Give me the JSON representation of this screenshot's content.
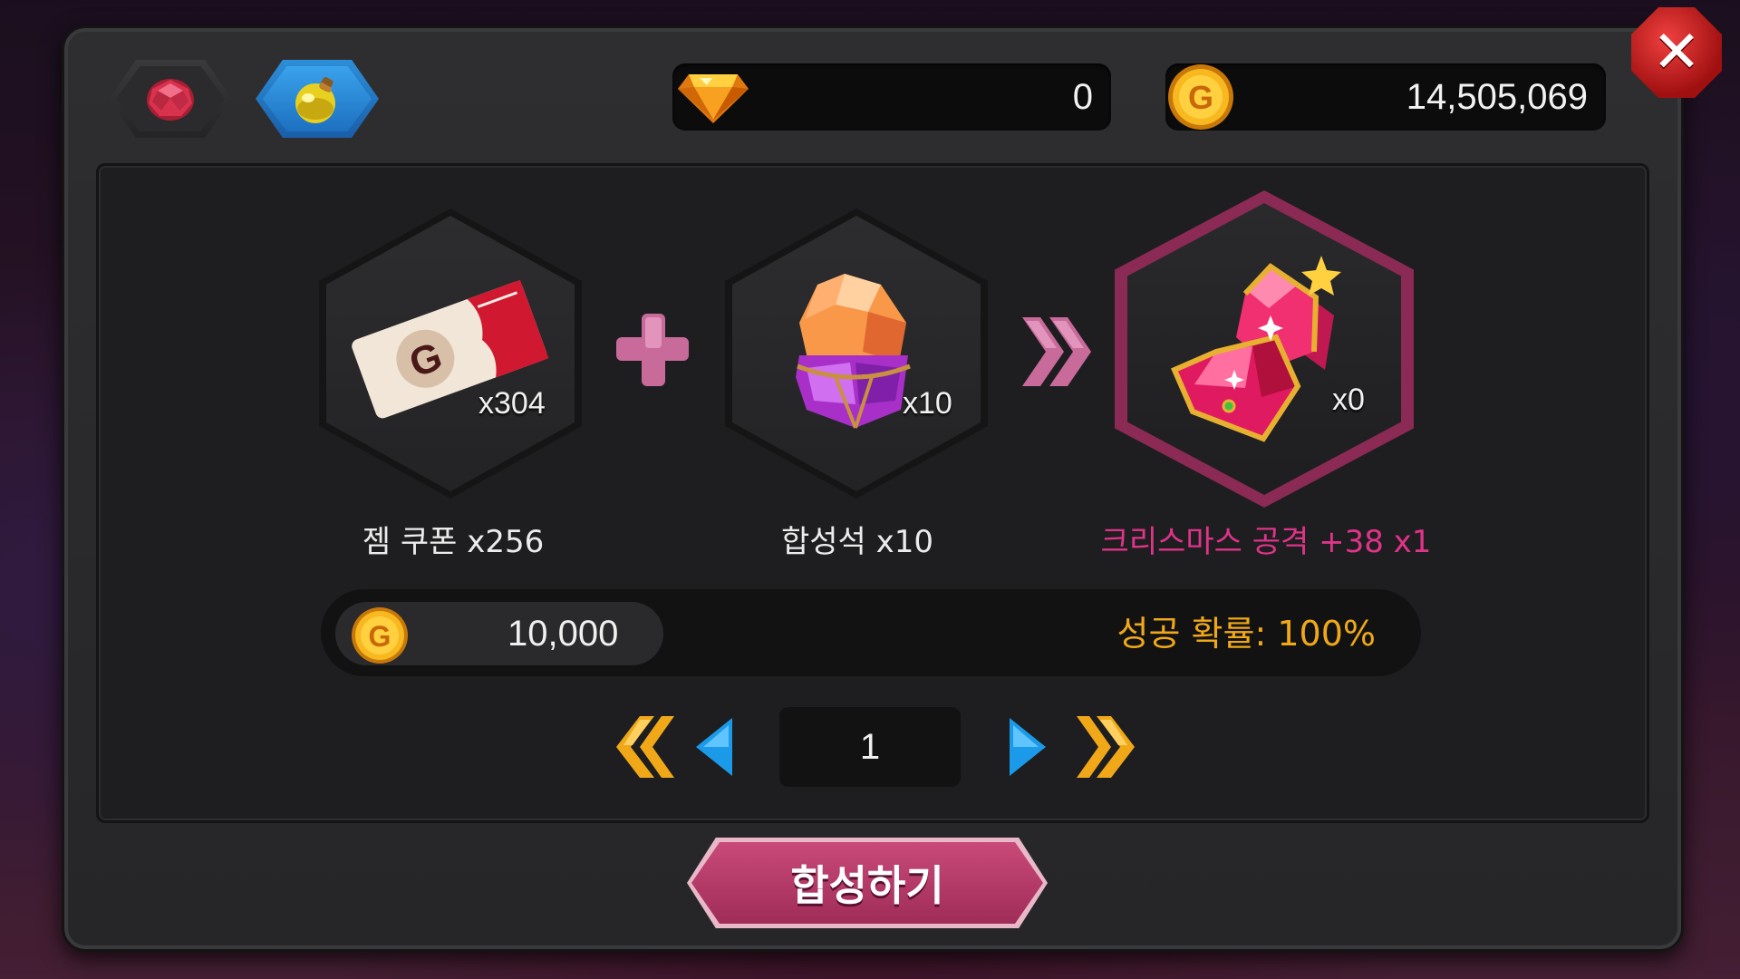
{
  "tabs": [
    {
      "icon": "ruby-icon",
      "selected": false
    },
    {
      "icon": "potion-icon",
      "selected": true
    }
  ],
  "currency": {
    "gems": "0",
    "gold": "14,505,069"
  },
  "close_icon": "close-icon",
  "synthesis": {
    "ingredient1": {
      "icon": "gem-coupon-ticket-icon",
      "owned": "x304",
      "label": "젬 쿠폰 x256"
    },
    "ingredient2": {
      "icon": "synthesis-stone-icon",
      "owned": "x10",
      "label": "합성석 x10"
    },
    "result": {
      "icon": "christmas-attack-gem-icon",
      "owned": "x0",
      "label": "크리스마스 공격 +38 x1"
    }
  },
  "cost": {
    "gold": "10,000",
    "success_rate": "성공 확률: 100%"
  },
  "pagination": {
    "current_page": "1"
  },
  "action_button": {
    "label": "합성하기"
  },
  "colors": {
    "result_label": "#e0338a",
    "success_text": "#f0a818",
    "button": "#b8396a",
    "nav_blue": "#1a9ae8",
    "nav_gold": "#f0a818"
  }
}
